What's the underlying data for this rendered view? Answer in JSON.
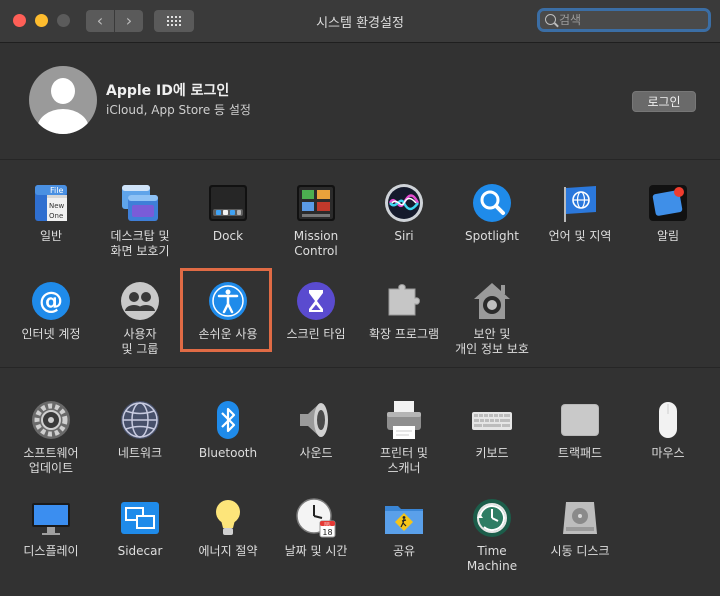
{
  "window": {
    "title": "시스템 환경설정"
  },
  "search": {
    "placeholder": "검색"
  },
  "account": {
    "title": "Apple ID에 로그인",
    "subtitle": "iCloud, App Store 등 설정",
    "login_label": "로그인"
  },
  "panes": {
    "general": "일반",
    "desktop": "데스크탑 및\n화면 보호기",
    "dock": "Dock",
    "mission": "Mission\nControl",
    "siri": "Siri",
    "spotlight": "Spotlight",
    "language": "언어 및 지역",
    "notifications": "알림",
    "internet": "인터넷 계정",
    "users": "사용자\n및 그룹",
    "accessibility": "손쉬운 사용",
    "screentime": "스크린 타임",
    "extensions": "확장 프로그램",
    "security": "보안 및\n개인 정보 보호",
    "software": "소프트웨어\n업데이트",
    "network": "네트워크",
    "bluetooth": "Bluetooth",
    "sound": "사운드",
    "printers": "프린터 및\n스캐너",
    "keyboard": "키보드",
    "trackpad": "트랙패드",
    "mouse": "마우스",
    "displays": "디스플레이",
    "sidecar": "Sidecar",
    "energy": "에너지 절약",
    "datetime": "날짜 및 시간",
    "sharing": "공유",
    "timemachine": "Time\nMachine",
    "startup": "시동 디스크"
  },
  "icon_texts": {
    "file": "File",
    "new": "New",
    "one": "One",
    "calendar_month": "JUL",
    "calendar_day": "18"
  },
  "colors": {
    "highlight": "#e06b45",
    "search_focus": "#3b6ea5",
    "accent_blue": "#1f8bea"
  }
}
